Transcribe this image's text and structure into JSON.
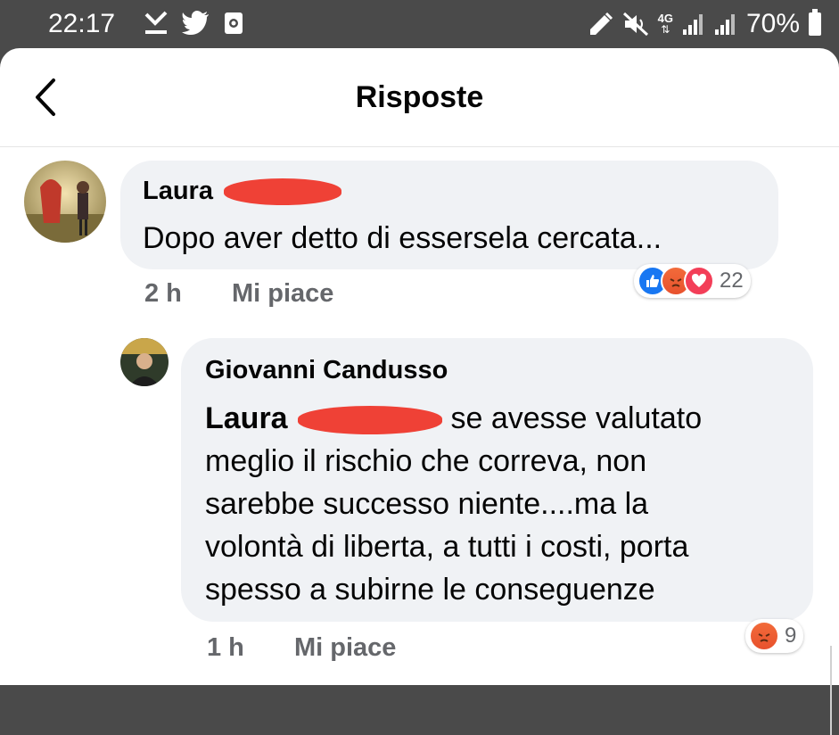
{
  "status_bar": {
    "time": "22:17",
    "network": "4G",
    "battery": "70%",
    "left_icons": [
      "download-done-icon",
      "twitter-icon",
      "screen-record-icon"
    ],
    "right_icons": [
      "data-saver-icon",
      "mute-icon",
      "network-4g-icon",
      "signal-icon",
      "signal-icon",
      "battery-icon"
    ]
  },
  "header": {
    "title": "Risposte",
    "back_icon": "chevron-left-icon"
  },
  "comments": [
    {
      "author": "Laura",
      "text": "Dopo aver detto di essersela cercata...",
      "time": "2 h",
      "like_label": "Mi piace",
      "reactions": [
        "like",
        "angry",
        "love"
      ],
      "reaction_count": "22"
    },
    {
      "author": "Giovanni Candusso",
      "mention": "Laura",
      "text_first_line": "se avesse valutato",
      "text_lines": [
        "meglio il rischio che correva, non",
        "sarebbe successo niente....ma la",
        "volontà di liberta, a tutti i costi, porta",
        "spesso a subirne le conseguenze"
      ],
      "time": "1 h",
      "like_label": "Mi piace",
      "reactions": [
        "angry"
      ],
      "reaction_count": "9"
    }
  ],
  "colors": {
    "status_bar": "#4a4a4a",
    "bubble": "#f0f2f5",
    "redaction": "#ef4136",
    "meta_text": "#65676b",
    "like": "#1877f2",
    "love": "#f33e58",
    "angry": "#f26b3a"
  }
}
